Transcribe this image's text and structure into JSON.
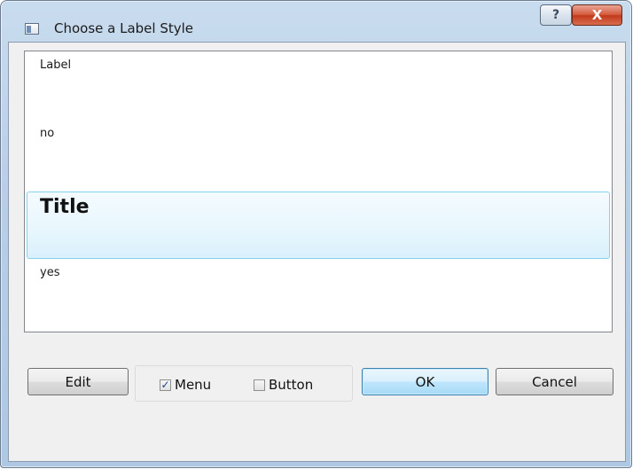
{
  "window": {
    "title": "Choose a Label Style",
    "help_glyph": "?",
    "close_glyph": "X"
  },
  "list": {
    "items": [
      {
        "text": "Label"
      },
      {
        "text": "no"
      },
      {
        "text": "Title",
        "selected": true
      },
      {
        "text": "yes"
      }
    ]
  },
  "footer": {
    "edit_label": "Edit",
    "menu_label": "Menu",
    "menu_checked": true,
    "button_label": "Button",
    "button_checked": false,
    "ok_label": "OK",
    "cancel_label": "Cancel",
    "check_glyph": "✓"
  }
}
